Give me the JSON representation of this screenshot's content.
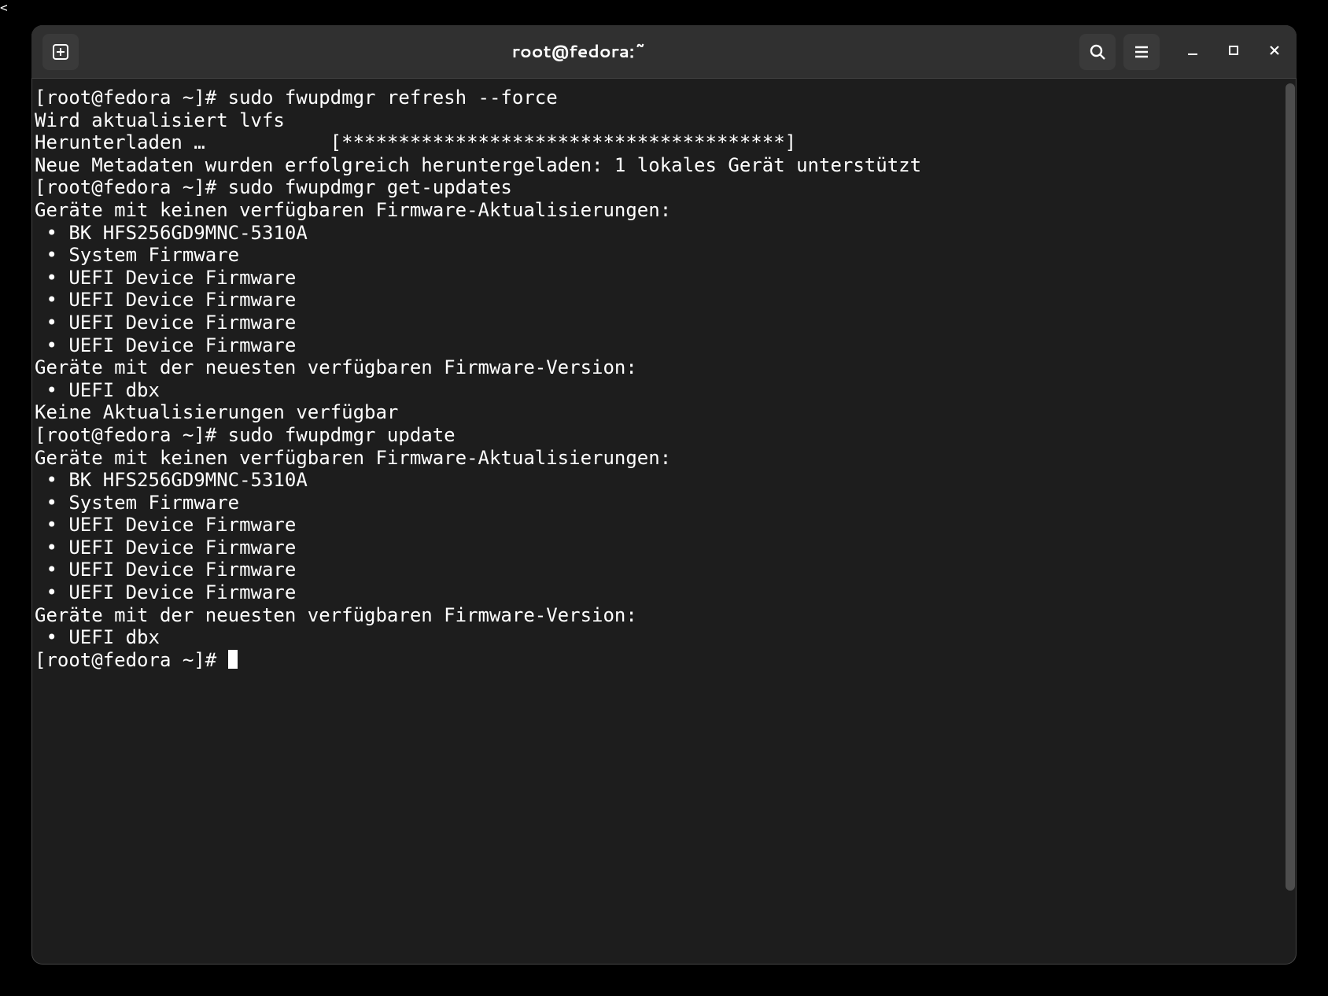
{
  "titlebar": {
    "title": "root@fedora:~",
    "new_tab_icon": "plus-icon",
    "search_icon": "search-icon",
    "menu_icon": "hamburger-icon",
    "minimize_icon": "minimize-icon",
    "maximize_icon": "maximize-icon",
    "close_icon": "close-icon"
  },
  "terminal": {
    "prompt": "[root@fedora ~]# ",
    "lines": [
      "[root@fedora ~]# sudo fwupdmgr refresh --force",
      "Wird aktualisiert lvfs",
      "Herunterladen …           [***************************************]",
      "Neue Metadaten wurden erfolgreich heruntergeladen: 1 lokales Gerät unterstützt",
      "[root@fedora ~]# sudo fwupdmgr get-updates",
      "Geräte mit keinen verfügbaren Firmware-Aktualisierungen:",
      " • BK HFS256GD9MNC-5310A",
      " • System Firmware",
      " • UEFI Device Firmware",
      " • UEFI Device Firmware",
      " • UEFI Device Firmware",
      " • UEFI Device Firmware",
      "Geräte mit der neuesten verfügbaren Firmware-Version:",
      " • UEFI dbx",
      "Keine Aktualisierungen verfügbar",
      "[root@fedora ~]# sudo fwupdmgr update",
      "Geräte mit keinen verfügbaren Firmware-Aktualisierungen:",
      " • BK HFS256GD9MNC-5310A",
      " • System Firmware",
      " • UEFI Device Firmware",
      " • UEFI Device Firmware",
      " • UEFI Device Firmware",
      " • UEFI Device Firmware",
      "Geräte mit der neuesten verfügbaren Firmware-Version:",
      " • UEFI dbx"
    ],
    "final_prompt": "[root@fedora ~]# "
  }
}
